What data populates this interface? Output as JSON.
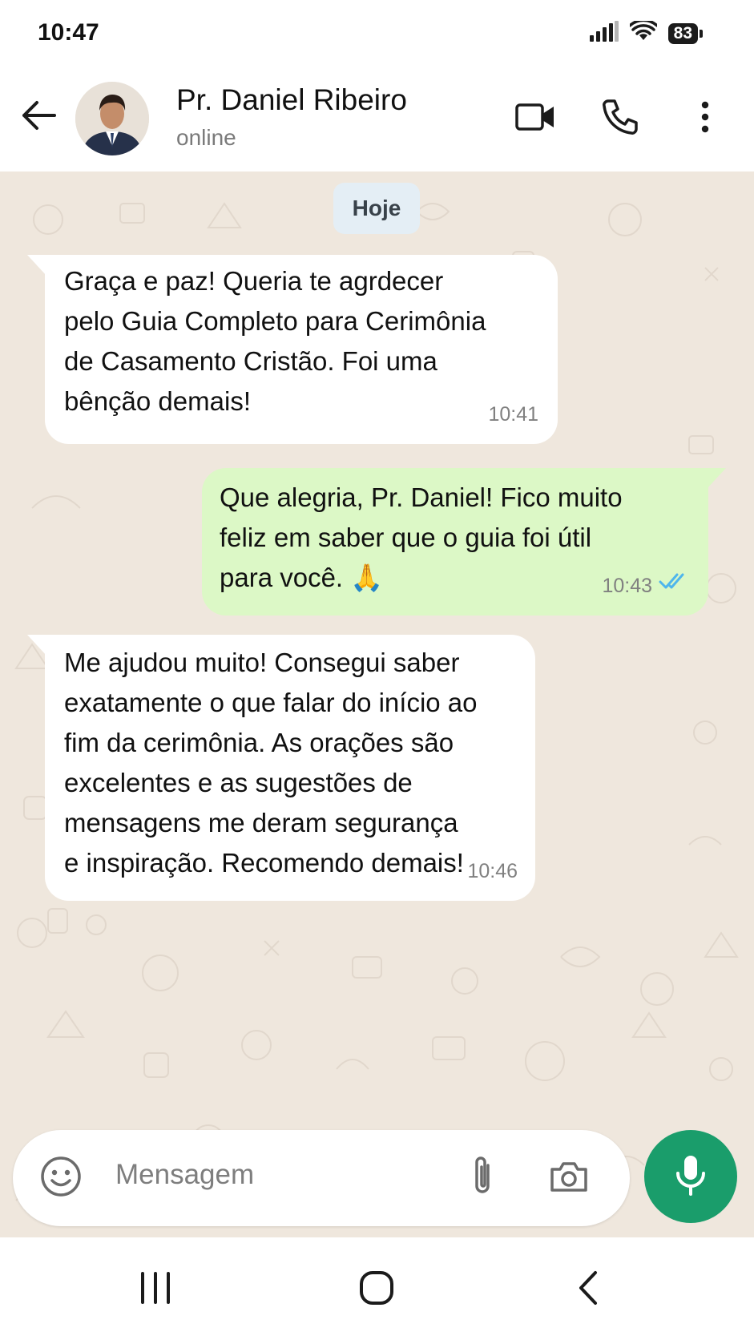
{
  "status_bar": {
    "time": "10:47",
    "battery": "83",
    "icons": [
      "signal-icon",
      "wifi-icon",
      "battery-icon"
    ]
  },
  "header": {
    "contact_name": "Pr. Daniel Ribeiro",
    "contact_status": "online",
    "icons": [
      "back-arrow-icon",
      "video-call-icon",
      "phone-icon",
      "more-vert-icon"
    ]
  },
  "chat": {
    "date_label": "Hoje",
    "messages": [
      {
        "direction": "incoming",
        "text": "Graça e paz! Queria te agrdecer\npelo Guia Completo para Cerimônia\nde Casamento Cristão. Foi uma\nbênção demais!",
        "time": "10:41"
      },
      {
        "direction": "outgoing",
        "text": "Que alegria, Pr. Daniel! Fico muito\nfeliz em saber que o guia foi útil\npara você. 🙏",
        "time": "10:43",
        "status": "read"
      },
      {
        "direction": "incoming",
        "text": "Me ajudou muito! Consegui saber\nexatamente o que falar do início ao\nfim da cerimônia. As orações são\nexcelentes e as sugestões de\nmensagens me deram segurança\ne inspiração. Recomendo demais!",
        "time": "10:46"
      }
    ]
  },
  "input": {
    "placeholder": "Mensagem",
    "icons": [
      "emoji-icon",
      "attach-icon",
      "camera-icon",
      "mic-icon"
    ]
  },
  "colors": {
    "accent": "#1a9d6b",
    "outgoing_bubble": "#dcf8c6",
    "incoming_bubble": "#ffffff",
    "chat_background": "#efe7dd",
    "read_ticks": "#4fb6ec"
  },
  "nav_bar": {
    "icons": [
      "recents-icon",
      "home-icon",
      "back-nav-icon"
    ]
  }
}
